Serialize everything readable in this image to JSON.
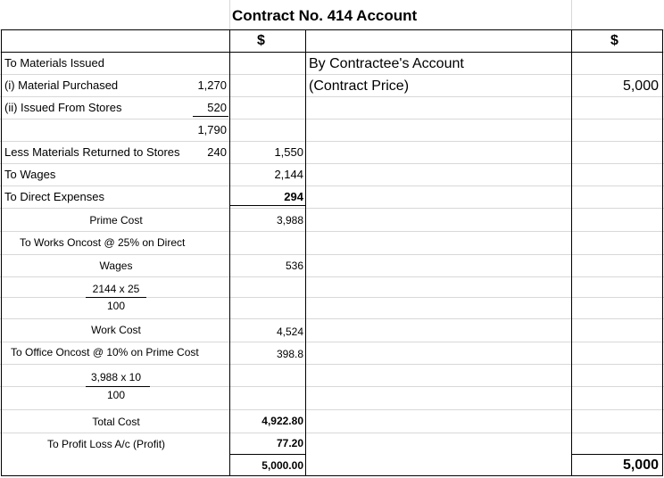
{
  "title": "Contract No. 414 Account",
  "currency_left": "$",
  "currency_right": "$",
  "debit": {
    "materials_issued": "To Materials Issued",
    "material_purchased": "(i) Material Purchased",
    "material_purchased_amt": "1,270",
    "issued_from_stores": "(ii) Issued From Stores",
    "issued_from_stores_amt": "520",
    "materials_subtotal": "1,790",
    "less_returned": "Less Materials Returned to Stores",
    "less_returned_amt": "240",
    "materials_net": "1,550",
    "wages": "To Wages",
    "wages_amt": "2,144",
    "direct_expenses": "To Direct Expenses",
    "direct_expenses_amt": "294",
    "prime_cost": "Prime Cost",
    "prime_cost_amt": "3,988",
    "works_oncost": "To Works Oncost @ 25% on Direct",
    "works_oncost_wages": "Wages",
    "works_oncost_amt": "536",
    "works_calc_num": "2144 x 25",
    "works_calc_den": "100",
    "work_cost": "Work Cost",
    "work_cost_amt": "4,524",
    "office_oncost": "To Office Oncost @ 10% on Prime Cost",
    "office_oncost_amt": "398.8",
    "office_calc_num": "3,988 x 10",
    "office_calc_den": "100",
    "total_cost": "Total Cost",
    "total_cost_amt": "4,922.80",
    "profit": "To Profit Loss A/c (Profit)",
    "profit_amt": "77.20",
    "total": "5,000.00"
  },
  "credit": {
    "contractee": "By Contractee's Account",
    "contract_price": "(Contract Price)",
    "contract_price_amt": "5,000",
    "total": "5,000"
  }
}
